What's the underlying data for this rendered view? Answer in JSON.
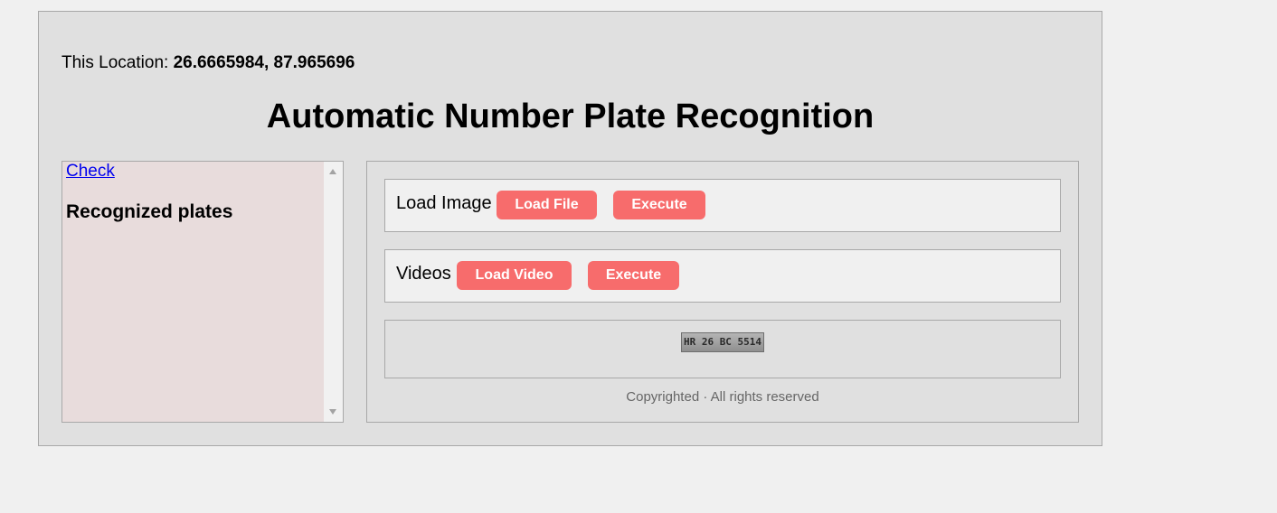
{
  "location": {
    "label": "This Location:",
    "coordinates": "26.6665984, 87.965696"
  },
  "page_title": "Automatic Number Plate Recognition",
  "sidebar": {
    "check_link": "Check",
    "heading": "Recognized plates"
  },
  "image_row": {
    "label": "Load Image",
    "load_button": "Load File",
    "execute_button": "Execute"
  },
  "video_row": {
    "label": "Videos",
    "load_button": "Load Video",
    "execute_button": "Execute"
  },
  "result": {
    "plate_text": "HR 26 BC 5514"
  },
  "footer": {
    "text": "Copyrighted · All rights reserved"
  },
  "colors": {
    "button_bg": "#f76c6c",
    "panel_bg": "#e0e0e0",
    "sidebar_bg": "#e8dcdc",
    "link": "#0000ee"
  }
}
